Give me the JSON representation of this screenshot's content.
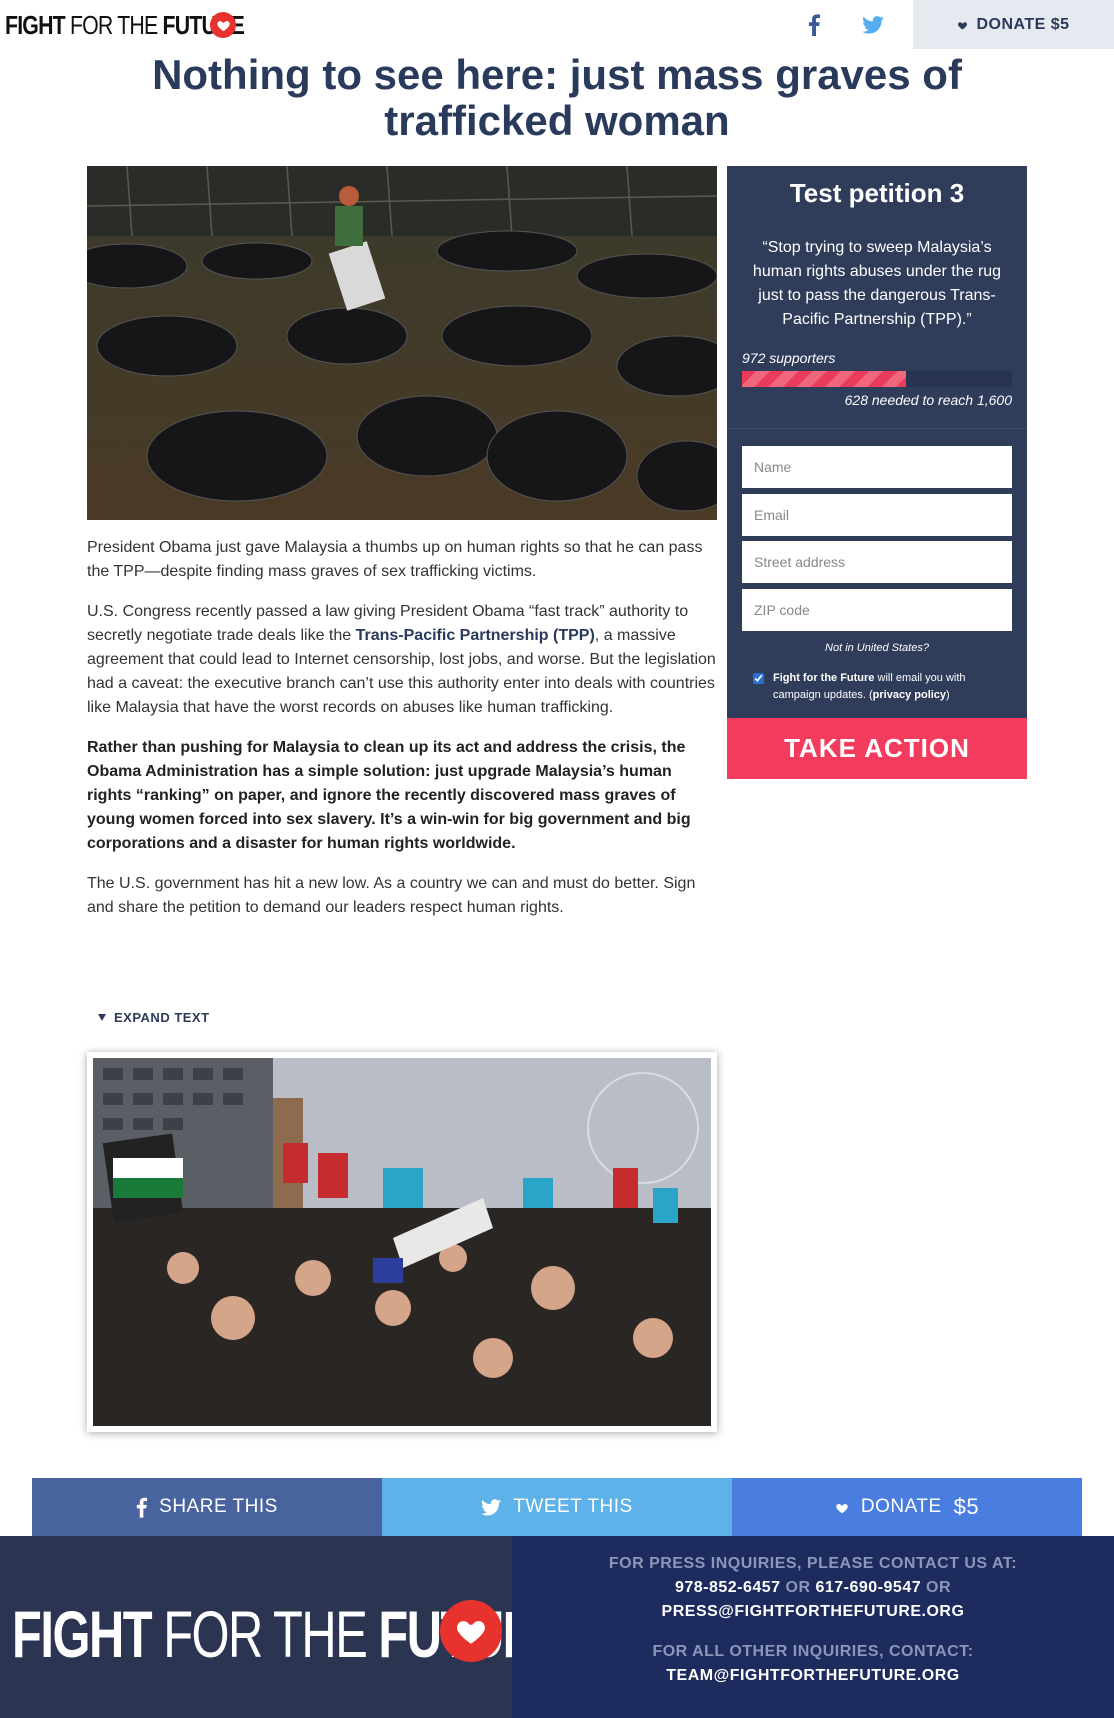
{
  "header": {
    "logo": "FIGHT FOR THE FUTURE",
    "donate_label": "DONATE $5"
  },
  "title": "Nothing to see here: just mass graves of trafficked woman",
  "article": {
    "p1": "President Obama just gave Malaysia a thumbs up on human rights so that he can pass the TPP—despite finding mass graves of sex trafficking victims.",
    "p2_before": "U.S. Congress recently passed a law giving President Obama “fast track” authority to secretly negotiate trade deals like the ",
    "p2_link": "Trans-Pacific Partnership (TPP)",
    "p2_after": ", a massive agreement that could lead to Internet censorship, lost jobs, and worse. But the legislation had a caveat: the executive branch can’t use this authority enter into deals with countries like Malaysia that have the worst records on abuses like human trafficking.",
    "p3": "Rather than pushing for Malaysia to clean up its act and address the crisis, the Obama Administration has a simple solution: just upgrade Malaysia’s human rights “ranking” on paper, and ignore the recently discovered mass graves of young women forced into sex slavery. It’s a win-win for big government and big corporations and a disaster for human rights worldwide.",
    "p4": "The U.S. government has hit a new low. As a country we can and must do better. Sign and share the petition to demand our leaders respect human rights.",
    "expand_label": "EXPAND TEXT"
  },
  "petition": {
    "title": "Test petition 3",
    "quote": "“Stop trying to sweep Malaysia’s human rights abuses under the rug just to pass the dangerous Trans-Pacific Partnership (TPP).”",
    "supporters": "972 supporters",
    "needed": "628 needed to reach 1,600",
    "progress_fraction": 0.6075,
    "placeholders": {
      "name": "Name",
      "email": "Email",
      "street": "Street address",
      "zip": "ZIP code"
    },
    "not_us": "Not in United States?",
    "optin_org": "Fight for the Future",
    "optin_text": " will email you with campaign updates. (",
    "optin_privacy": "privacy policy",
    "optin_end": ")",
    "submit_label": "TAKE ACTION"
  },
  "sharebar": {
    "share_label": "SHARE THIS",
    "tweet_label": "TWEET THIS",
    "donate_label": "DONATE",
    "donate_amount": "$5"
  },
  "footer": {
    "logo": "FIGHT FOR THE FUTURE",
    "press_heading": "FOR PRESS INQUIRIES, PLEASE CONTACT US AT:",
    "phone1": "978-852-6457",
    "or1": " OR ",
    "phone2": "617-690-9547",
    "or2": " OR",
    "press_email": "PRESS@FIGHTFORTHEFUTURE.ORG",
    "other_heading": "FOR ALL OTHER INQUIRIES, CONTACT:",
    "team_email": "TEAM@FIGHTFORTHEFUTURE.ORG"
  },
  "colors": {
    "navy": "#293a5b",
    "panel": "#2f3c5a",
    "cta": "#f33b5e",
    "facebook": "#49639e",
    "twitter": "#5eb2ea",
    "donate": "#4a7de0",
    "heart": "#e8322e"
  },
  "icons": [
    "heart-icon",
    "facebook-icon",
    "twitter-icon",
    "caret-down-icon",
    "checkbox-icon"
  ]
}
